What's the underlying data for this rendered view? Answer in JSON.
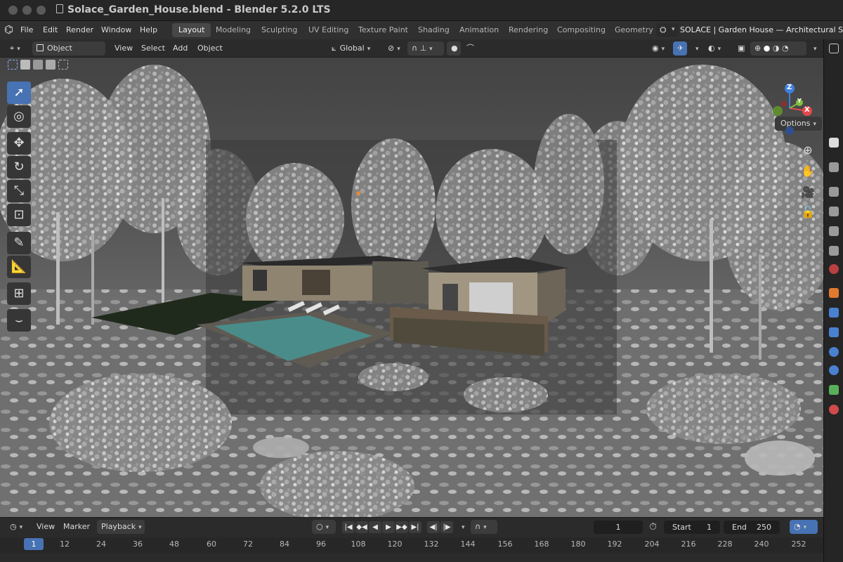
{
  "window": {
    "title": "Solace_Garden_House.blend - Blender 5.2.0 LTS"
  },
  "menu": [
    "File",
    "Edit",
    "Render",
    "Window",
    "Help"
  ],
  "workspaces": [
    "Layout",
    "Modeling",
    "Sculpting",
    "UV Editing",
    "Texture Paint",
    "Shading",
    "Animation",
    "Rendering",
    "Compositing",
    "Geometry"
  ],
  "active_workspace": "Layout",
  "scene_name": "SOLACE | Garden House — Architectural Stud",
  "viewport_header": {
    "mode": "Object Mode",
    "view": "View",
    "select": "Select",
    "add": "Add",
    "object": "Object",
    "orientation": "Global",
    "options": "Options"
  },
  "gizmo": {
    "z": "Z",
    "y": "Y",
    "x": "X"
  },
  "timeline": {
    "view": "View",
    "marker": "Marker",
    "playback": "Playback",
    "current_frame": "1",
    "start_label": "Start",
    "start_value": "1",
    "end_label": "End",
    "end_value": "250",
    "ruler": [
      "1",
      "12",
      "24",
      "36",
      "48",
      "60",
      "72",
      "84",
      "96",
      "108",
      "120",
      "132",
      "144",
      "156",
      "168",
      "180",
      "192",
      "204",
      "216",
      "228",
      "240",
      "252"
    ]
  },
  "colors": {
    "accent": "#4772b3",
    "axis_x": "#e04a4a",
    "axis_y": "#7fbf3f",
    "axis_z": "#3f7fdf"
  },
  "icons": {
    "blender_logo": "blender-icon",
    "tools": [
      "select-box-icon",
      "cursor-icon",
      "move-icon",
      "rotate-icon",
      "scale-icon",
      "transform-icon",
      "annotate-icon",
      "measure-icon",
      "add-cube-icon",
      "curve-icon"
    ],
    "nav": [
      "zoom-icon",
      "pan-hand-icon",
      "camera-icon",
      "lock-icon"
    ]
  }
}
